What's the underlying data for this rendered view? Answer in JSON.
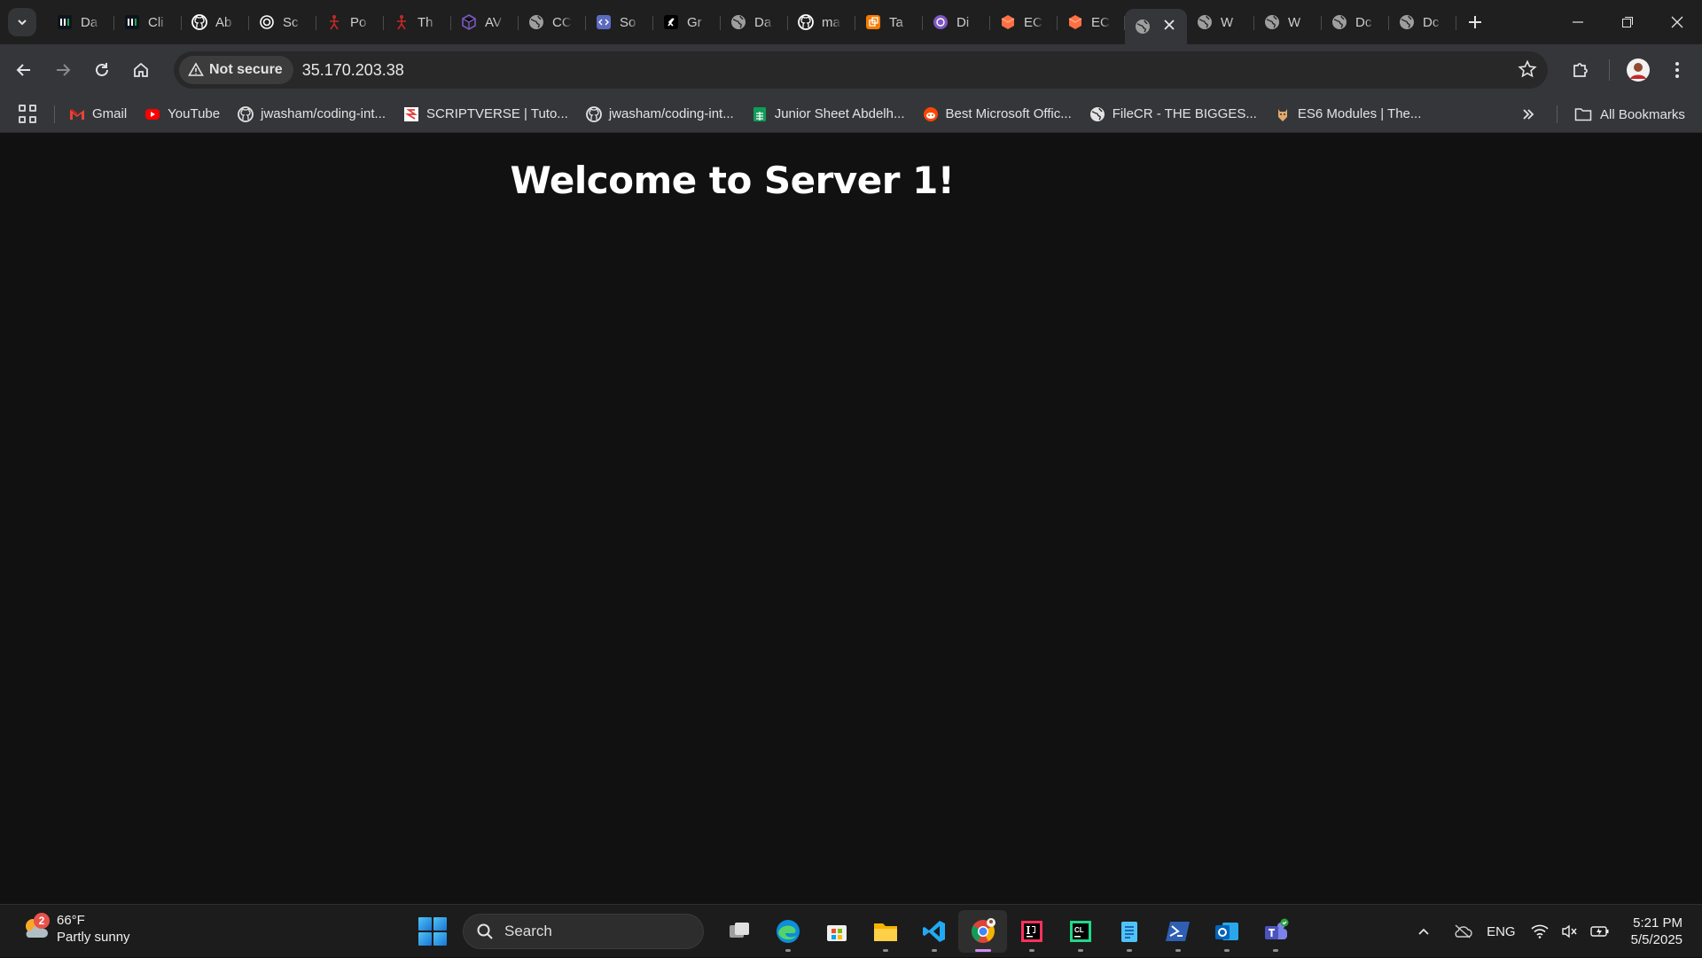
{
  "tabs": [
    {
      "title": "Da",
      "icon": "hackerrank-icon",
      "color": "#1ba94c"
    },
    {
      "title": "Cli",
      "icon": "hackerrank-icon",
      "color": "#1ba94c"
    },
    {
      "title": "Ab",
      "icon": "github-icon",
      "color": "#ffffff"
    },
    {
      "title": "Sc",
      "icon": "openai-icon",
      "color": "#ffffff"
    },
    {
      "title": "Po",
      "icon": "figure-icon",
      "color": "#c62828"
    },
    {
      "title": "Th",
      "icon": "figure-icon",
      "color": "#c62828"
    },
    {
      "title": "AV",
      "icon": "cube-icon",
      "color": "#7e57c2"
    },
    {
      "title": "CC",
      "icon": "globe-icon",
      "color": "#9e9e9e"
    },
    {
      "title": "So",
      "icon": "code-icon",
      "color": "#5c6bc0"
    },
    {
      "title": "Gr",
      "icon": "grok-icon",
      "color": "#ffffff"
    },
    {
      "title": "Da",
      "icon": "globe-icon",
      "color": "#9e9e9e"
    },
    {
      "title": "ma",
      "icon": "github-icon",
      "color": "#ffffff"
    },
    {
      "title": "Ta",
      "icon": "tabs-icon",
      "color": "#f57c00"
    },
    {
      "title": "Di",
      "icon": "discord-icon",
      "color": "#7e57c2"
    },
    {
      "title": "EC",
      "icon": "aws-icon",
      "color": "#ff7043"
    },
    {
      "title": "EC",
      "icon": "aws-icon",
      "color": "#ff7043"
    },
    {
      "title": "",
      "icon": "globe-icon",
      "color": "#9e9e9e",
      "active": true
    },
    {
      "title": "W",
      "icon": "globe-icon",
      "color": "#9e9e9e"
    },
    {
      "title": "W",
      "icon": "globe-icon",
      "color": "#9e9e9e"
    },
    {
      "title": "Dc",
      "icon": "globe-icon",
      "color": "#9e9e9e"
    },
    {
      "title": "Dc",
      "icon": "globe-icon",
      "color": "#9e9e9e"
    }
  ],
  "toolbar": {
    "security_label": "Not secure",
    "url": "35.170.203.38"
  },
  "bookmarks": [
    {
      "label": "Gmail",
      "icon": "gmail-icon"
    },
    {
      "label": "YouTube",
      "icon": "youtube-icon"
    },
    {
      "label": "jwasham/coding-int...",
      "icon": "github-icon"
    },
    {
      "label": "SCRIPTVERSE | Tuto...",
      "icon": "scriptverse-icon"
    },
    {
      "label": "jwasham/coding-int...",
      "icon": "github-icon"
    },
    {
      "label": "Junior Sheet Abdelh...",
      "icon": "sheets-icon"
    },
    {
      "label": "Best Microsoft Offic...",
      "icon": "reddit-icon"
    },
    {
      "label": "FileCR - THE BIGGES...",
      "icon": "globe-icon"
    },
    {
      "label": "ES6 Modules | The...",
      "icon": "es6-icon"
    }
  ],
  "all_bookmarks_label": "All Bookmarks",
  "page": {
    "heading": "Welcome to Server 1!"
  },
  "taskbar": {
    "weather_temp": "66°F",
    "weather_desc": "Partly sunny",
    "weather_badge": "2",
    "search_label": "Search",
    "apps": [
      {
        "name": "task-view-icon"
      },
      {
        "name": "edge-icon"
      },
      {
        "name": "store-icon"
      },
      {
        "name": "file-explorer-icon"
      },
      {
        "name": "vscode-icon"
      },
      {
        "name": "chrome-icon",
        "active": true
      },
      {
        "name": "intellij-icon"
      },
      {
        "name": "clion-icon"
      },
      {
        "name": "notepad-icon"
      },
      {
        "name": "powershell-icon"
      },
      {
        "name": "outlook-icon"
      },
      {
        "name": "teams-icon"
      }
    ],
    "language": "ENG",
    "time": "5:21 PM",
    "date": "5/5/2025"
  }
}
